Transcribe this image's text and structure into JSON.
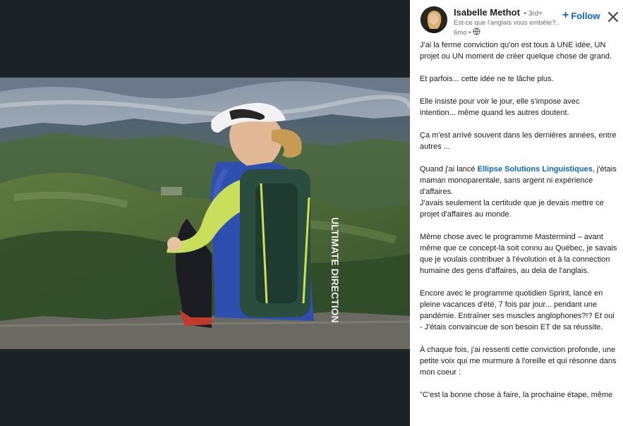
{
  "post": {
    "author": {
      "name": "Isabelle Methot",
      "degree": "• 3rd+",
      "headline": "Est-ce que l'anglais vous embête?...",
      "time": "6mo •"
    },
    "follow_label": "Follow",
    "paragraphs": [
      "J'ai la ferme conviction qu'on est tous à UNE idée, UN projet ou UN moment de créer quelque chose de grand.",
      "Et parfois... cette idée ne te lâche plus.",
      "Elle insiste pour voir le jour, elle s'impose avec intention... même quand les autres doutent.",
      "Ça m'est arrivé souvent dans les dernières années, entre autres ...",
      {
        "before": "Quand j'ai lancé ",
        "link": "Ellipse Solutions Linguistiques",
        "after": ", j'étais maman monoparentale, sans argent ni expérience d'affaires."
      },
      "J'avais seulement la certitude que je devais mettre ce projet d'affaires au monde.",
      "Même chose avec le programme Mastermind – avant même que ce concept-là soit connu au Québec, je savais que je voulais contribuer à l'évolution et à la connection humaine des gens d'affaires, au dela de l'anglais.",
      "Encore avec le programme quotidien Sprint, lancé en pleine vacances d'été, 7 fois par jour... pendant une pandémie. Entraîner ses muscles anglophones?!? Et oui - J'étais convaincue de son besoin ET de sa réussite.",
      "À chaque fois, j'ai ressenti cette conviction profonde, une petite voix qui me murmure à l'oreille et qui résonne dans mon coeur :",
      "\"C'est la bonne chose à faire, la prochaine étape, même"
    ]
  },
  "photo": {
    "backpack_text": "ULTIMATE DIRECTION"
  },
  "colors": {
    "accent": "#0a66c2",
    "media_background": "#1d2226",
    "panel_background": "#ffffff"
  },
  "icons": {
    "close": "close-icon",
    "globe": "globe-icon",
    "plus": "plus-icon"
  }
}
